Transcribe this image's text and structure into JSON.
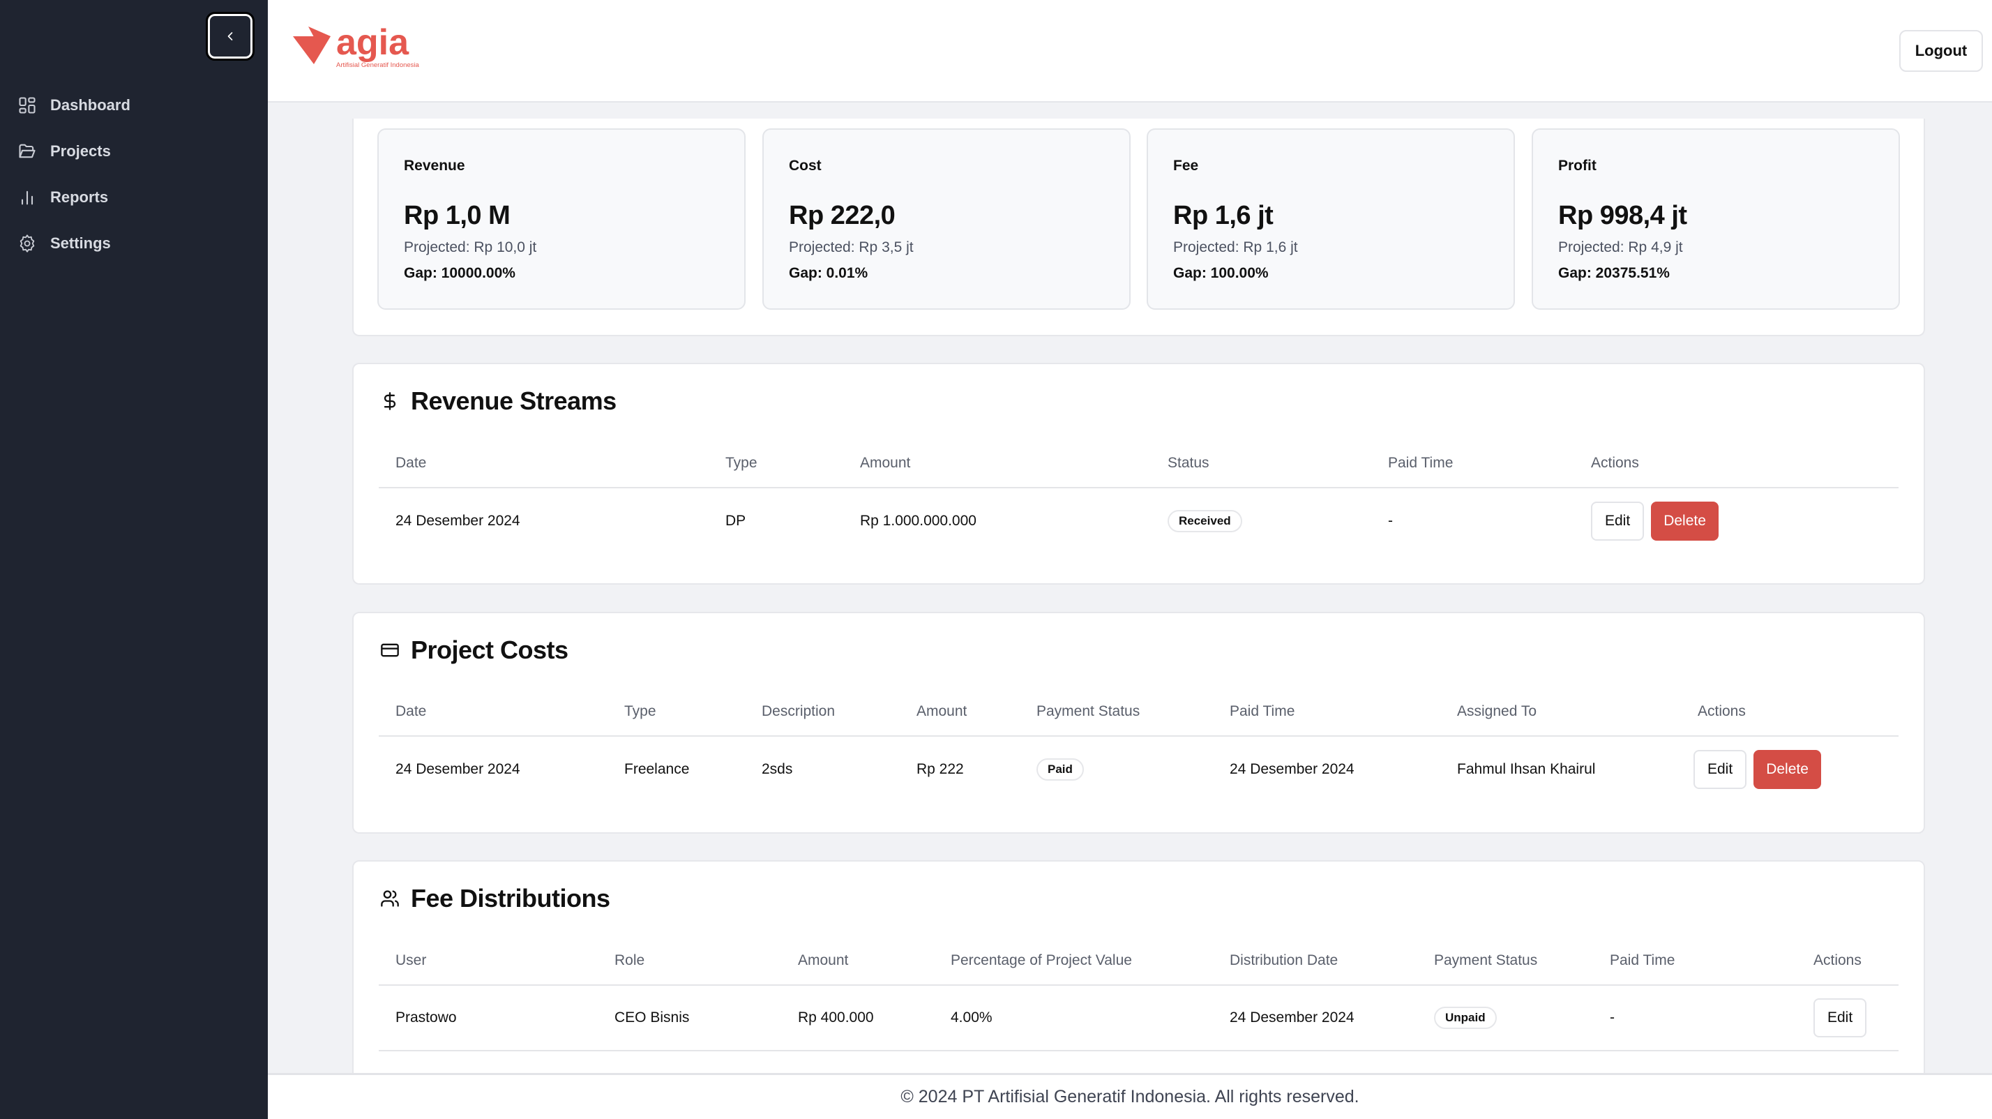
{
  "sidebar": {
    "collapse_icon": "chevron-left-icon",
    "items": [
      {
        "label": "Dashboard",
        "icon": "dashboard-grid-icon"
      },
      {
        "label": "Projects",
        "icon": "folder-open-icon"
      },
      {
        "label": "Reports",
        "icon": "bar-chart-icon"
      },
      {
        "label": "Settings",
        "icon": "gear-icon"
      }
    ]
  },
  "header": {
    "logo_text": "agia",
    "logo_tagline": "Artifisial Generatif Indonesia",
    "logout_label": "Logout",
    "brand_color": "#e5584f"
  },
  "summary": {
    "cards": [
      {
        "label": "Revenue",
        "value": "Rp 1,0 M",
        "projected": "Projected: Rp 10,0 jt",
        "gap": "Gap: 10000.00%"
      },
      {
        "label": "Cost",
        "value": "Rp 222,0",
        "projected": "Projected: Rp 3,5 jt",
        "gap": "Gap: 0.01%"
      },
      {
        "label": "Fee",
        "value": "Rp 1,6 jt",
        "projected": "Projected: Rp 1,6 jt",
        "gap": "Gap: 100.00%"
      },
      {
        "label": "Profit",
        "value": "Rp 998,4 jt",
        "projected": "Projected: Rp 4,9 jt",
        "gap": "Gap: 20375.51%"
      }
    ]
  },
  "revenue_streams": {
    "title": "Revenue Streams",
    "icon": "dollar-icon",
    "columns": [
      "Date",
      "Type",
      "Amount",
      "Status",
      "Paid Time",
      "Actions"
    ],
    "rows": [
      {
        "date": "24 Desember 2024",
        "type": "DP",
        "amount": "Rp 1.000.000.000",
        "status": "Received",
        "paid_time": "-",
        "edit": "Edit",
        "delete": "Delete"
      }
    ]
  },
  "project_costs": {
    "title": "Project Costs",
    "icon": "credit-card-icon",
    "columns": [
      "Date",
      "Type",
      "Description",
      "Amount",
      "Payment Status",
      "Paid Time",
      "Assigned To",
      "Actions"
    ],
    "rows": [
      {
        "date": "24 Desember 2024",
        "type": "Freelance",
        "description": "2sds",
        "amount": "Rp 222",
        "payment_status": "Paid",
        "paid_time": "24 Desember 2024",
        "assigned_to": "Fahmul Ihsan Khairul",
        "edit": "Edit",
        "delete": "Delete"
      }
    ]
  },
  "fee_distributions": {
    "title": "Fee Distributions",
    "icon": "users-icon",
    "columns": [
      "User",
      "Role",
      "Amount",
      "Percentage of Project Value",
      "Distribution Date",
      "Payment Status",
      "Paid Time",
      "Actions"
    ],
    "rows": [
      {
        "user": "Prastowo",
        "role": "CEO Bisnis",
        "amount": "Rp 400.000",
        "percentage": "4.00%",
        "distribution_date": "24 Desember 2024",
        "payment_status": "Unpaid",
        "paid_time": "-",
        "edit": "Edit"
      }
    ]
  },
  "footer": {
    "text": "© 2024 PT Artifisial Generatif Indonesia. All rights reserved."
  }
}
